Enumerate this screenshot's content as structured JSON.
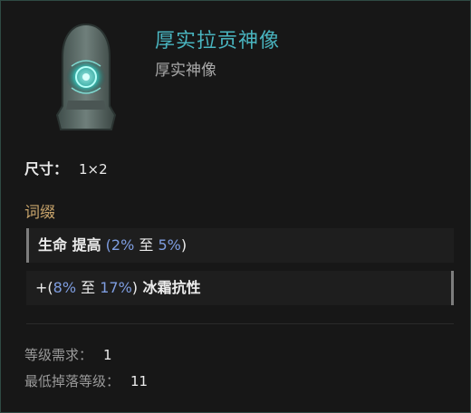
{
  "item": {
    "name": "厚实拉贡神像",
    "base_type": "厚实神像",
    "icon": "idol-statue-icon"
  },
  "size": {
    "label": "尺寸：",
    "value": "1×2"
  },
  "affixes": {
    "title": "词缀",
    "mod1": {
      "stat": "生命 提高",
      "open": " (",
      "min": "2%",
      "to": " 至 ",
      "max": "5%",
      "close": ")"
    },
    "mod2": {
      "prefix": "+(",
      "min": "8%",
      "to": " 至 ",
      "max": "17%",
      "close": ")",
      "stat": " 冰霜抗性"
    }
  },
  "requirements": {
    "level_label": "等级需求：",
    "level_value": "1",
    "drop_label": "最低掉落等级：",
    "drop_value": "11"
  },
  "colors": {
    "title": "#49b4bf",
    "affix_header": "#c8a46b",
    "range": "#7e9de0"
  }
}
